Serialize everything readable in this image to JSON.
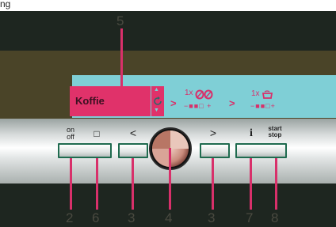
{
  "caption_fragment": "ng",
  "display": {
    "product_name": "Koffie",
    "strength_prefix": "1x",
    "strength_scale": "−■■□ +",
    "cup_prefix": "1x",
    "cup_scale": "−■■□+",
    "arrow_glyph": ">",
    "scroll_up_glyph": "▲",
    "scroll_down_glyph": "▼"
  },
  "controls": {
    "onoff_label_top": "on",
    "onoff_label_bottom": "off",
    "menu_label_glyph": "□",
    "prev_label": "<",
    "next_label": ">",
    "info_label": "i",
    "startstop_label_top": "start",
    "startstop_label_bottom": "stop"
  },
  "callouts": {
    "display": "5",
    "onoff": "2",
    "menu": "6",
    "prev": "3",
    "dial": "4",
    "next": "3",
    "info": "7",
    "startstop": "8"
  },
  "colors": {
    "accent": "#d8306a",
    "display_bg": "#7fcfd6",
    "button_border": "#1f6b4f"
  }
}
